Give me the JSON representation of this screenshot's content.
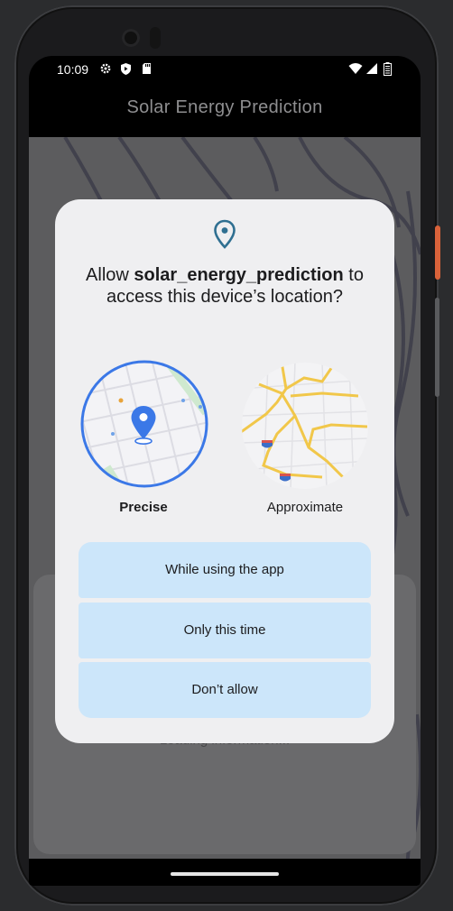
{
  "status_bar": {
    "time": "10:09",
    "icons": [
      "gear-icon",
      "shield-icon",
      "sd-card-icon",
      "wifi-icon",
      "signal-icon",
      "battery-icon"
    ]
  },
  "app_bar": {
    "title": "Solar Energy Prediction"
  },
  "background": {
    "loading_text": "Loading information..."
  },
  "dialog": {
    "icon": "location-pin-icon",
    "title_prefix": "Allow ",
    "app_name": "solar_energy_prediction",
    "title_suffix": " to access this device’s location?",
    "options": {
      "precise_label": "Precise",
      "approximate_label": "Approximate",
      "selected": "Precise"
    },
    "buttons": {
      "while_using": "While using the app",
      "only_this_time": "Only this time",
      "dont_allow": "Don’t allow"
    }
  },
  "colors": {
    "accent": "#3b78e7",
    "button_bg": "#cce6fa",
    "dialog_bg": "#efeff1",
    "pin": "#2f6f91"
  }
}
